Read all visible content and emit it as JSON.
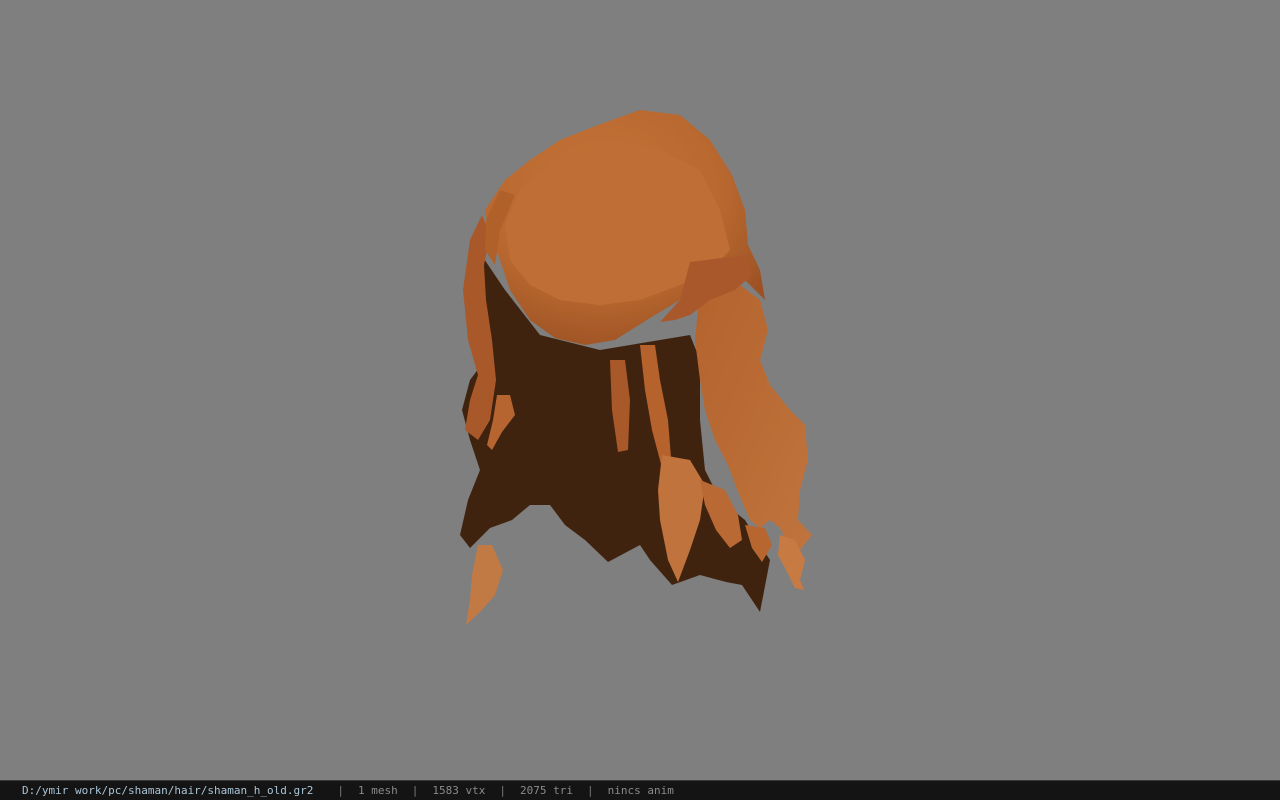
{
  "viewport": {
    "background_color": "#7f7f7f",
    "model_name": "shaman hair mesh",
    "model_colors": {
      "light": "#c06f37",
      "mid": "#a8572a",
      "dark": "#40230f"
    }
  },
  "statusbar": {
    "file_path": "D:/ymir work/pc/shaman/hair/shaman_h_old.gr2",
    "separator": "|",
    "mesh_count": "1 mesh",
    "vertex_count": "1583 vtx",
    "triangle_count": "2075 tri",
    "anim_status": "nincs anim",
    "path_color": "#a9c4d6",
    "text_color": "#8a8a8a",
    "background_color": "#141414"
  }
}
